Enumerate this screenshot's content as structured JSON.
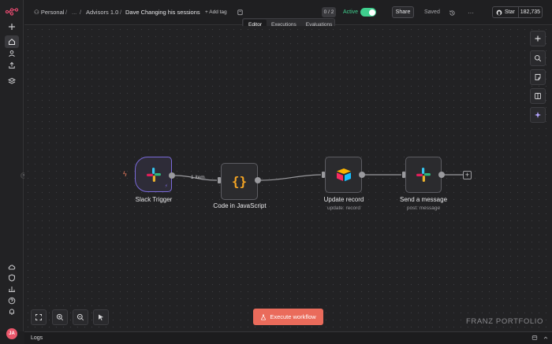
{
  "header": {
    "project": "Personal",
    "ellipsis": "...",
    "folder": "Advisors 1.0",
    "workflow_name": "Dave Changing his sessions",
    "add_tag": "+ Add tag",
    "counter": "0 / 2",
    "active_label": "Active",
    "active": true,
    "share": "Share",
    "saved": "Saved",
    "more": "···",
    "github_star": "Star",
    "github_count": "182,735"
  },
  "tabs": [
    {
      "label": "Editor",
      "selected": true
    },
    {
      "label": "Executions",
      "selected": false
    },
    {
      "label": "Evaluations",
      "selected": false
    }
  ],
  "nodes": {
    "slack_trigger": {
      "label": "Slack Trigger"
    },
    "code": {
      "label": "Code in JavaScript"
    },
    "update_record": {
      "label": "Update record",
      "sub": "update: record"
    },
    "send_message": {
      "label": "Send a message",
      "sub": "post: message"
    }
  },
  "edge_label": "1 item",
  "execute_button": "Execute workflow",
  "watermark": "FRANZ PORTFOLIO",
  "logs": {
    "label": "Logs"
  },
  "user": {
    "initials": "JA"
  },
  "colors": {
    "accent": "#ea6b5b",
    "active_green": "#3fcf8e",
    "trigger_border": "#7a6ad9",
    "code_braces": "#f5a524"
  }
}
